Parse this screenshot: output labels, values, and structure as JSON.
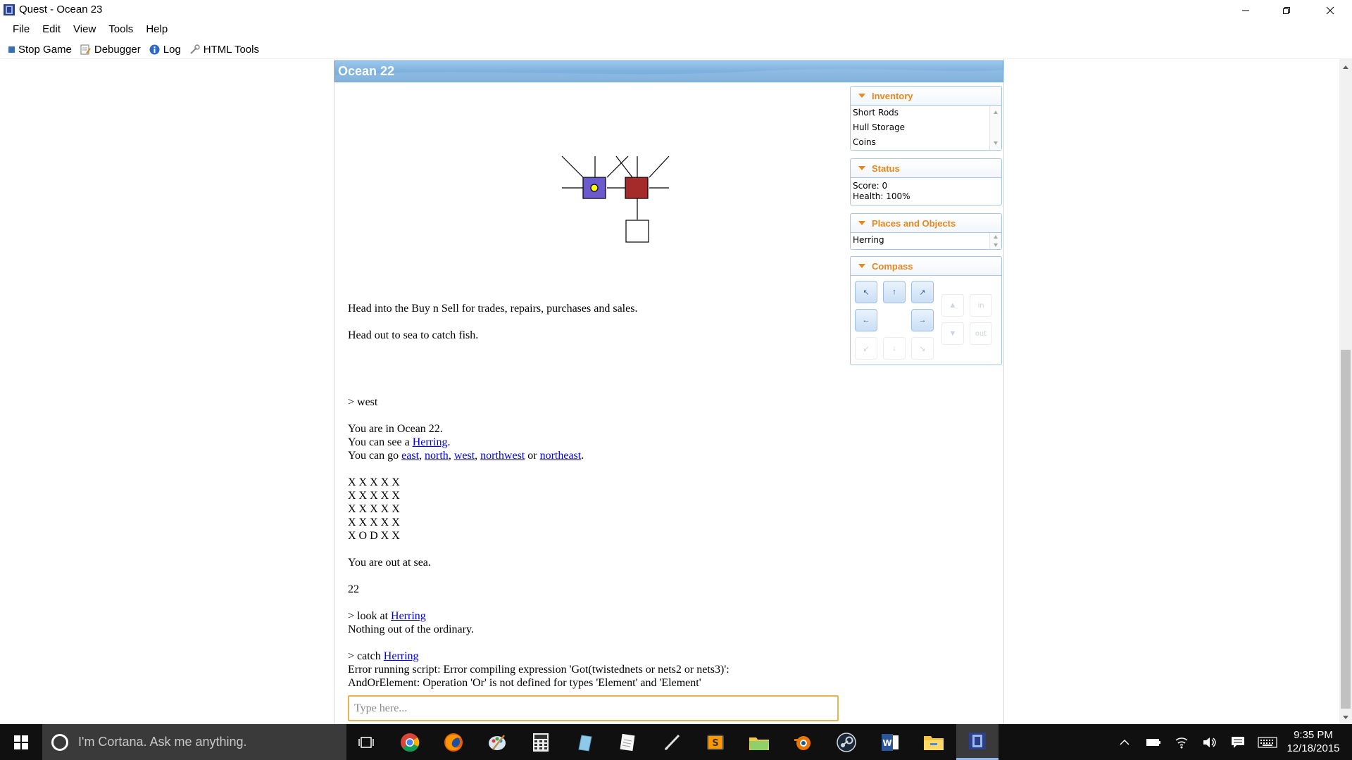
{
  "window": {
    "title": "Quest - Ocean 23"
  },
  "menu": [
    "File",
    "Edit",
    "View",
    "Tools",
    "Help"
  ],
  "toolbar": {
    "stop_game": "Stop Game",
    "debugger": "Debugger",
    "log": "Log",
    "html_tools": "HTML Tools"
  },
  "location": {
    "title": "Ocean 22"
  },
  "map": {
    "current_room_color": "#6a5acd",
    "adjacent_room_color": "#a52a2a",
    "player_marker_color": "#ffff00"
  },
  "output": {
    "intro_1": "Head into the Buy n Sell for trades, repairs, purchases and sales.",
    "intro_2": "Head out to sea to catch fish.",
    "cmd_west": "> west",
    "in_room": "You are in Ocean 22.",
    "see_prefix": "You can see a ",
    "see_object": "Herring",
    "see_suffix": ".",
    "go_prefix": "You can go ",
    "exits": [
      "east",
      "north",
      "west",
      "northwest",
      "northeast"
    ],
    "sep_1": ", ",
    "sep_or": " or ",
    "go_suffix": ".",
    "grid": [
      "X X X X X",
      "X X X X X",
      "X X X X X",
      "X X X X X",
      "X O D X X"
    ],
    "out_at_sea": "You are out at sea.",
    "number": "22",
    "cmd_look_prefix": "> look at ",
    "cmd_look_object": "Herring",
    "look_result": "Nothing out of the ordinary.",
    "cmd_catch_prefix": "> catch ",
    "cmd_catch_object": "Herring",
    "error_1": "Error running script: Error compiling expression 'Got(twistednets or nets2 or nets3)':",
    "error_2": "AndOrElement: Operation 'Or' is not defined for types 'Element' and 'Element'"
  },
  "input": {
    "placeholder": "Type here...",
    "value": ""
  },
  "panes": {
    "inventory": {
      "title": "Inventory",
      "items": [
        "Short Rods",
        "Hull Storage",
        "Coins"
      ]
    },
    "status": {
      "title": "Status",
      "lines": [
        "Score: 0",
        "Health: 100%"
      ]
    },
    "places": {
      "title": "Places and Objects",
      "items": [
        "Herring"
      ]
    },
    "compass": {
      "title": "Compass",
      "in_label": "in",
      "out_label": "out"
    }
  },
  "taskbar": {
    "cortana_placeholder": "I'm Cortana. Ask me anything.",
    "time": "9:35 PM",
    "date": "12/18/2015"
  },
  "colors": {
    "accent_orange": "#e8871e",
    "link_blue": "#0000ee",
    "header_blue": "#7fb3df"
  }
}
